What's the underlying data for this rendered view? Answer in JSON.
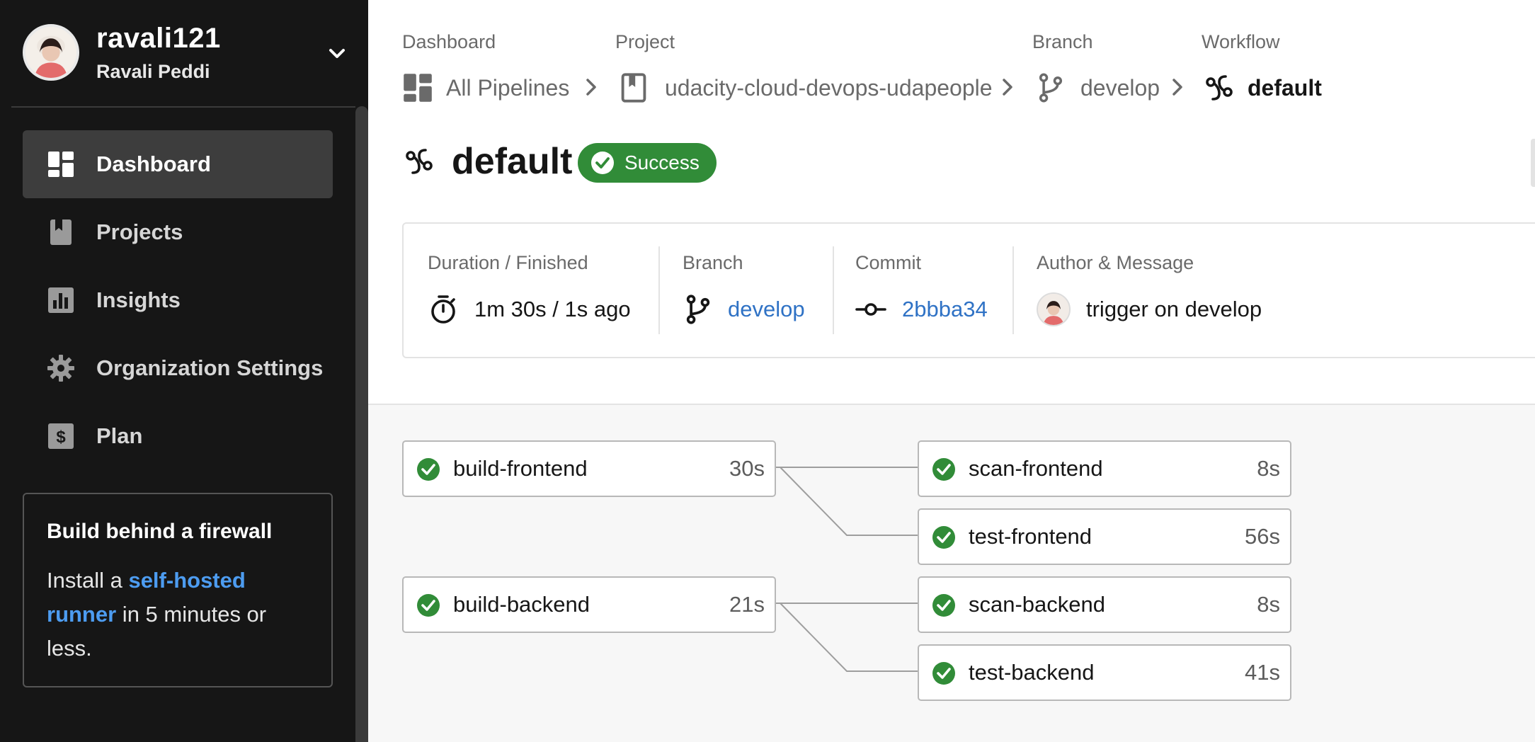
{
  "user": {
    "username": "ravali121",
    "full_name": "Ravali Peddi"
  },
  "nav": [
    {
      "label": "Dashboard",
      "icon": "dashboard-icon",
      "active": true
    },
    {
      "label": "Projects",
      "icon": "projects-icon",
      "active": false
    },
    {
      "label": "Insights",
      "icon": "insights-icon",
      "active": false
    },
    {
      "label": "Organization Settings",
      "icon": "gear-icon",
      "active": false
    },
    {
      "label": "Plan",
      "icon": "dollar-icon",
      "active": false
    }
  ],
  "promo": {
    "title": "Build behind a firewall",
    "text_before": "Install a ",
    "link": "self-hosted runner",
    "text_after": " in 5 minutes or less."
  },
  "breadcrumb": {
    "dashboard_label": "Dashboard",
    "dashboard_value": "All Pipelines",
    "project_label": "Project",
    "project_value": "udacity-cloud-devops-udapeople",
    "branch_label": "Branch",
    "branch_value": "develop",
    "workflow_label": "Workflow",
    "workflow_value": "default"
  },
  "workflow": {
    "name": "default",
    "status": "Success",
    "status_color": "#318c38"
  },
  "info": {
    "duration_label": "Duration / Finished",
    "duration_value": "1m 30s / 1s ago",
    "branch_label": "Branch",
    "branch_value": "develop",
    "commit_label": "Commit",
    "commit_value": "2bbba34",
    "author_label": "Author & Message",
    "message": "trigger on develop"
  },
  "jobs": [
    {
      "name": "build-frontend",
      "duration": "30s",
      "status": "success"
    },
    {
      "name": "scan-frontend",
      "duration": "8s",
      "status": "success"
    },
    {
      "name": "test-frontend",
      "duration": "56s",
      "status": "success"
    },
    {
      "name": "build-backend",
      "duration": "21s",
      "status": "success"
    },
    {
      "name": "scan-backend",
      "duration": "8s",
      "status": "success"
    },
    {
      "name": "test-backend",
      "duration": "41s",
      "status": "success"
    }
  ],
  "colors": {
    "accent_link": "#2f72c5",
    "success": "#318c38",
    "sidebar_bg": "#161616"
  }
}
